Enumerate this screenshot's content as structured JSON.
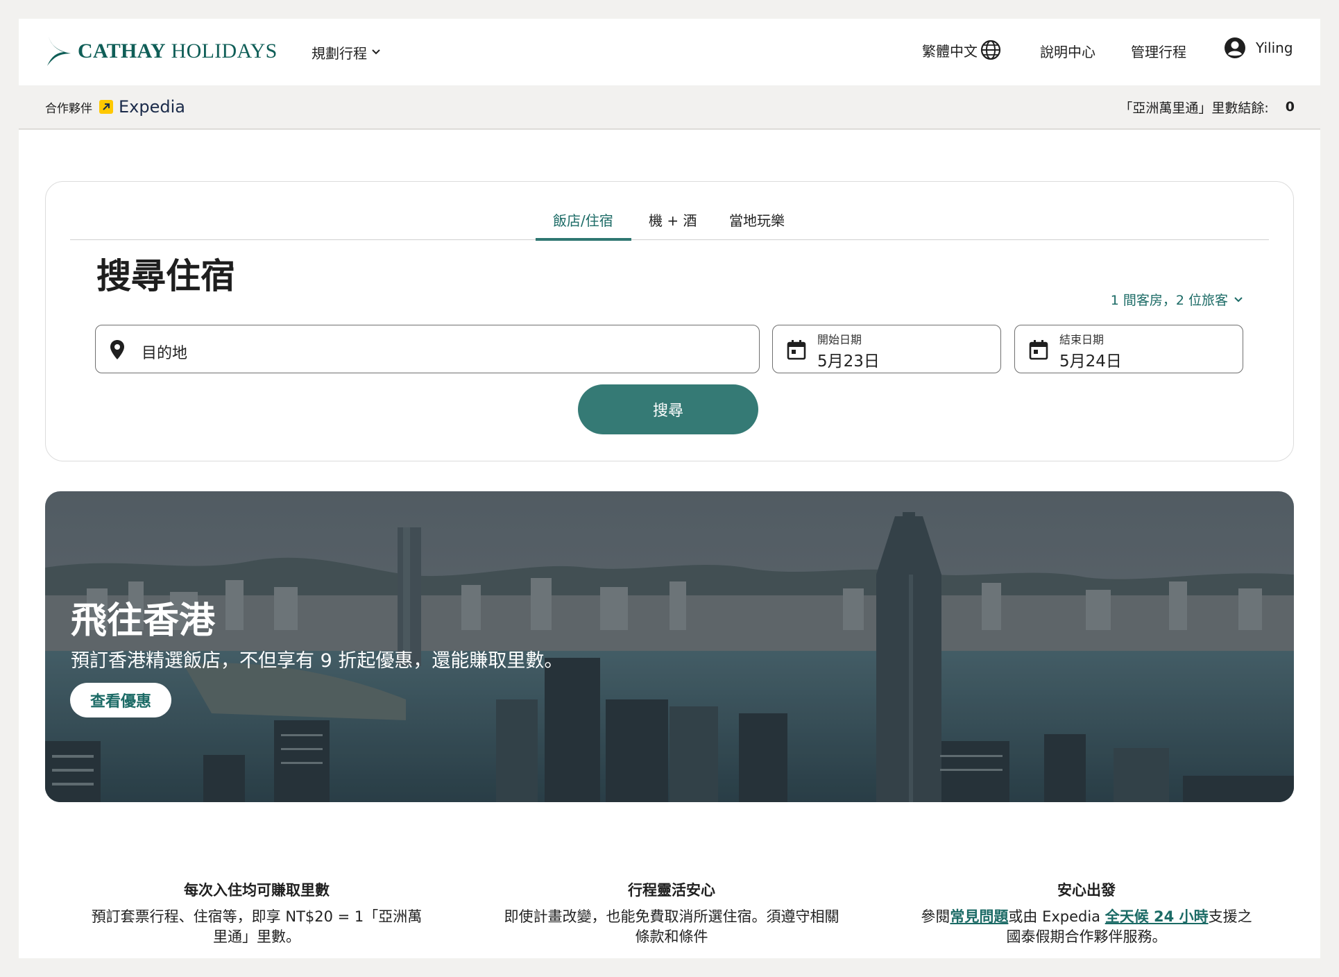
{
  "header": {
    "logo_brand": "CATHAY",
    "logo_product": "HOLIDAYS",
    "plan_menu_label": "規劃行程",
    "language_label": "繁體中文",
    "help_label": "說明中心",
    "manage_label": "管理行程",
    "user_name": "Yiling"
  },
  "subbar": {
    "partner_label": "合作夥伴",
    "partner_name": "Expedia",
    "miles_label": "「亞洲萬里通」里數結餘:",
    "miles_value": "0"
  },
  "search": {
    "tabs": [
      {
        "label": "飯店/住宿",
        "active": true
      },
      {
        "label": "機 + 酒",
        "active": false
      },
      {
        "label": "當地玩樂",
        "active": false
      }
    ],
    "title": "搜尋住宿",
    "rooms_guests": "1 間客房，2 位旅客",
    "destination_placeholder": "目的地",
    "start_label": "開始日期",
    "start_value": "5月23日",
    "end_label": "結束日期",
    "end_value": "5月24日",
    "submit_label": "搜尋"
  },
  "banner": {
    "title": "飛往香港",
    "subtitle": "預訂香港精選飯店，不但享有 9 折起優惠，還能賺取里數。",
    "cta_label": "查看優惠"
  },
  "features": [
    {
      "title": "每次入住均可賺取里數",
      "text": "預訂套票行程、住宿等，即享 NT$20 = 1「亞洲萬里通」里數。"
    },
    {
      "title": "行程靈活安心",
      "text": "即使計畫改變，也能免費取消所選住宿。須遵守相關條款和條件"
    },
    {
      "title": "安心出發",
      "text_before": "參閱",
      "link1": "常見問題",
      "text_middle": "或由 Expedia ",
      "link2": "全天候 24 小時",
      "text_after": "支援之國泰假期合作夥伴服務。"
    }
  ],
  "colors": {
    "brand_teal": "#357a75",
    "link_teal": "#1c6b66",
    "page_bg": "#f2f1ef"
  },
  "icons": [
    "cathay-wing-logo-icon",
    "chevron-down-icon",
    "globe-icon",
    "account-circle-icon",
    "expedia-arrow-icon",
    "location-pin-icon",
    "calendar-icon"
  ]
}
